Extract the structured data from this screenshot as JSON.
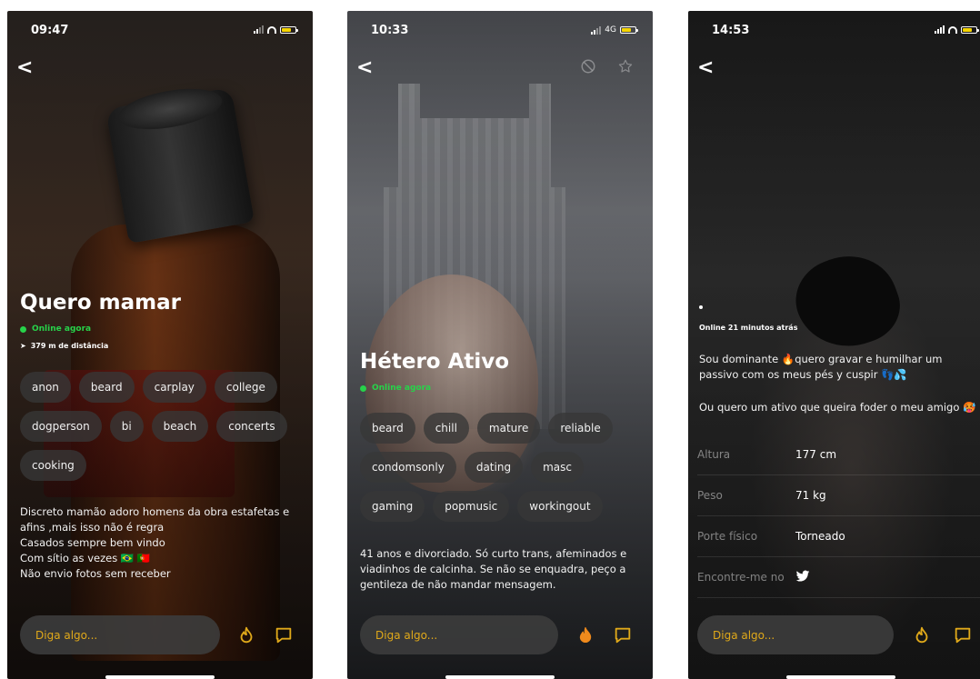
{
  "screens": [
    {
      "time": "09:47",
      "back": "<",
      "name": "Quero mamar",
      "status": "Online agora",
      "distance": "379 m de distância",
      "tags": [
        "anon",
        "beard",
        "carplay",
        "college",
        "dogperson",
        "bi",
        "beach",
        "concerts",
        "cooking"
      ],
      "bio": "Discreto mamão  adoro homens da obra estafetas e afins ,mais isso não é regra\nCasados sempre bem vindo\nCom sítio as vezes 🇧🇷 🇵🇹\nNão envio fotos sem receber",
      "input_placeholder": "Diga algo..."
    },
    {
      "time": "10:33",
      "network": "4G",
      "back": "<",
      "name": "Hétero Ativo",
      "status": "Online agora",
      "tags": [
        "beard",
        "chill",
        "mature",
        "reliable",
        "condomsonly",
        "dating",
        "masc",
        "gaming",
        "popmusic",
        "workingout"
      ],
      "bio": "41 anos e divorciado. Só curto trans, afeminados e viadinhos de calcinha. Se não se enquadra, peço a gentileza de não mandar mensagem.",
      "input_placeholder": "Diga algo..."
    },
    {
      "time": "14:53",
      "back": "<",
      "status": "Online 21 minutos atrás",
      "bio1": "Sou dominante 🔥quero gravar e humilhar um passivo com os meus pés y cuspir 👣💦",
      "bio2": "Ou quero um ativo que queira foder o meu amigo 🥵",
      "details": [
        {
          "label": "Altura",
          "value": "177 cm"
        },
        {
          "label": "Peso",
          "value": "71 kg"
        },
        {
          "label": "Porte físico",
          "value": "Torneado"
        },
        {
          "label": "Encontre-me no",
          "value": ""
        }
      ],
      "input_placeholder": "Diga algo..."
    }
  ],
  "colors": {
    "accent": "#e0a91a",
    "online": "#27d24a",
    "flame_active": "#f08a1c"
  }
}
